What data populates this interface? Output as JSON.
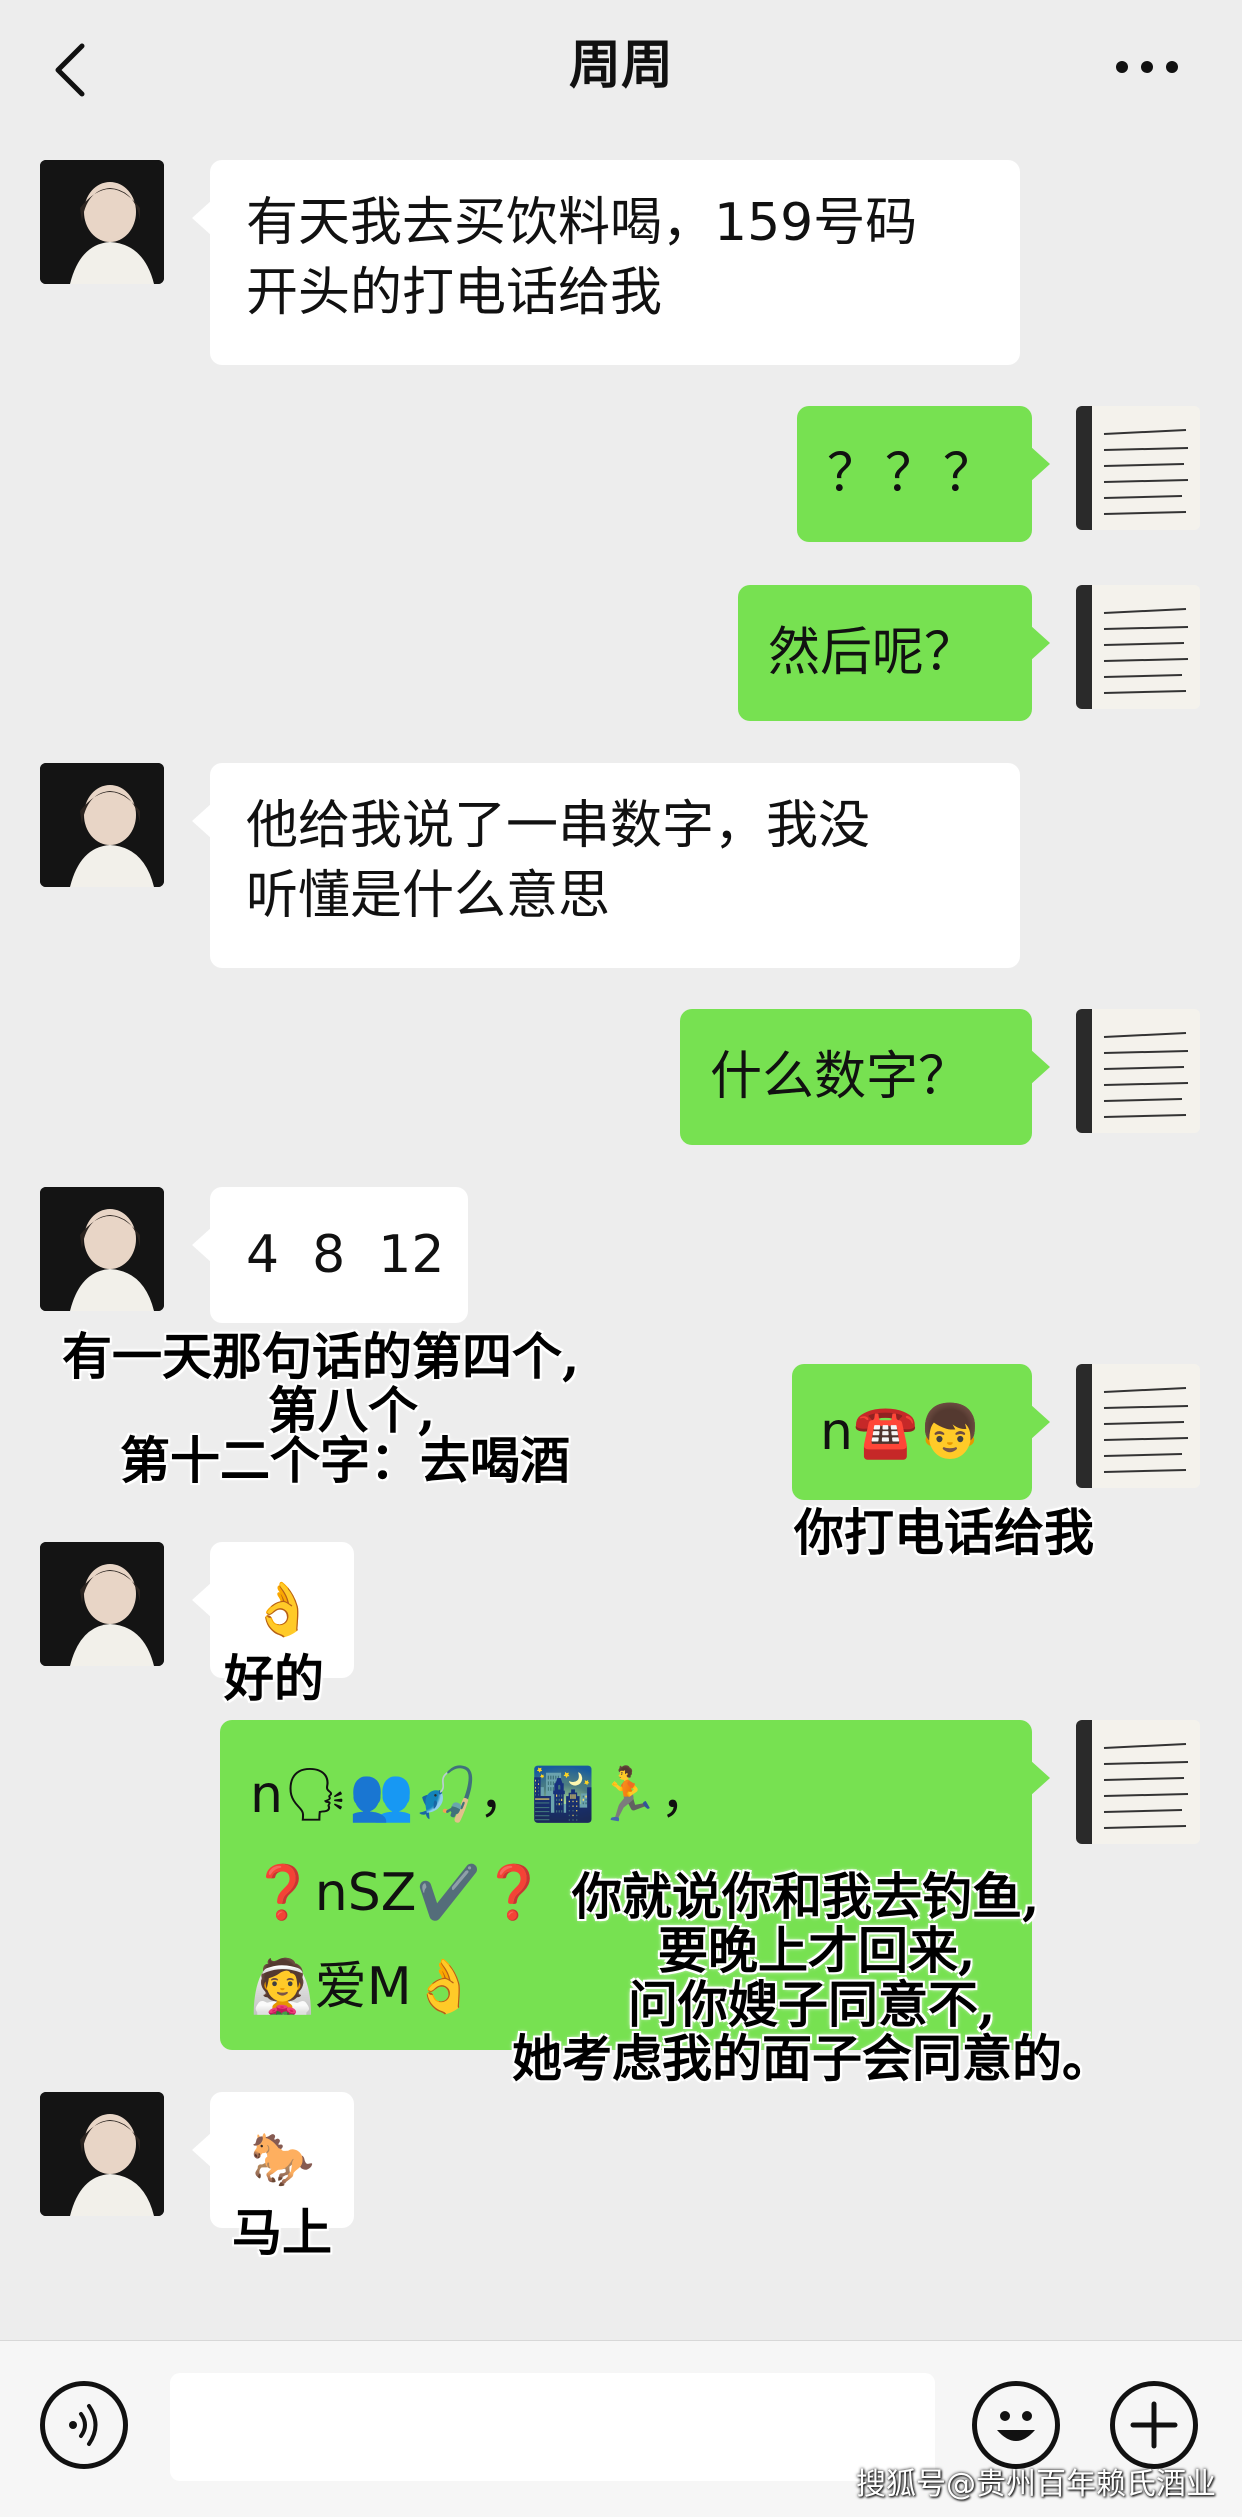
{
  "header": {
    "title": "周周",
    "back_icon": "chevron-left-icon",
    "more_icon": "more-dots-icon"
  },
  "messages": [
    {
      "side": "left",
      "line1": "有天我去买饮料喝，159号码",
      "line2": "开头的打电话给我"
    },
    {
      "side": "right",
      "text": "？？？"
    },
    {
      "side": "right",
      "text": "然后呢？"
    },
    {
      "side": "left",
      "line1": "他给我说了一串数字，我没",
      "line2": "听懂是什么意思"
    },
    {
      "side": "right",
      "text": "什么数字？"
    },
    {
      "side": "left",
      "text": "4  8  12"
    },
    {
      "side": "right",
      "text": "n☎️👦"
    },
    {
      "side": "left",
      "text": "👌"
    },
    {
      "side": "right",
      "line1": "n🗣👥🎣，🌃🏃，",
      "line2": "❓nSZ✔️❓",
      "line3": "👰爱M👌"
    },
    {
      "side": "left",
      "text": "🐎"
    }
  ],
  "captions": {
    "c1_l1": "有一天那句话的第四个,",
    "c1_l2": "第八个,",
    "c1_l3": "第十二个字：去喝酒",
    "c2": "你打电话给我",
    "c3": "好的",
    "c4_l1": "你就说你和我去钓鱼,",
    "c4_l2": "要晚上才回来,",
    "c4_l3": "问你嫂子同意不,",
    "c4_l4": "她考虑我的面子会同意的。",
    "c5": "马上"
  },
  "bottom_bar": {
    "voice_icon": "voice-icon",
    "emoji_icon": "emoji-face-icon",
    "plus_icon": "plus-icon",
    "input_value": ""
  },
  "watermark": "搜狐号@贵州百年赖氏酒业",
  "colors": {
    "background": "#ededed",
    "my_bubble": "#77e151",
    "their_bubble": "#ffffff"
  }
}
